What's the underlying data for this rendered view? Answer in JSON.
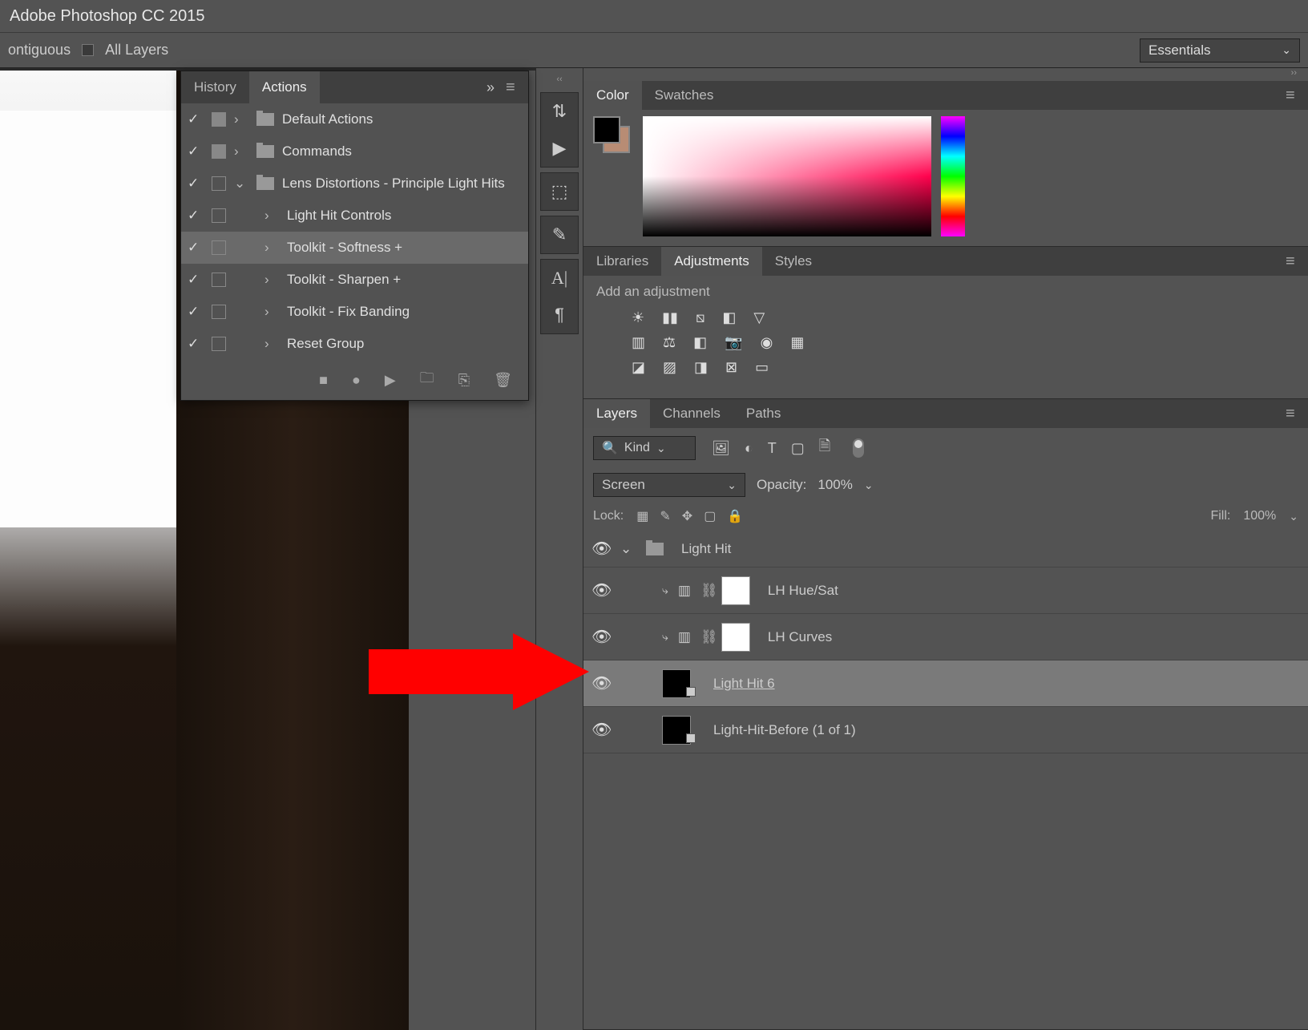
{
  "app": {
    "title": "Adobe Photoshop CC 2015"
  },
  "options": {
    "contiguous": "ontiguous",
    "all_layers": "All Layers"
  },
  "workspace": {
    "selected": "Essentials"
  },
  "history_panel": {
    "tabs": {
      "history": "History",
      "actions": "Actions"
    },
    "items": [
      {
        "check": true,
        "box": true,
        "expand": "›",
        "folder": true,
        "label": "Default Actions",
        "indent": 0
      },
      {
        "check": true,
        "box": true,
        "expand": "›",
        "folder": true,
        "label": "Commands",
        "indent": 0
      },
      {
        "check": true,
        "box": false,
        "expand": "⌄",
        "folder": true,
        "label": "Lens Distortions - Principle Light Hits",
        "indent": 0
      },
      {
        "check": true,
        "box": false,
        "expand": "›",
        "folder": false,
        "label": "Light Hit Controls",
        "indent": 1
      },
      {
        "check": true,
        "box": false,
        "expand": "›",
        "folder": false,
        "label": "Toolkit - Softness +",
        "indent": 1,
        "sel": true
      },
      {
        "check": true,
        "box": false,
        "expand": "›",
        "folder": false,
        "label": "Toolkit - Sharpen +",
        "indent": 1
      },
      {
        "check": true,
        "box": false,
        "expand": "›",
        "folder": false,
        "label": "Toolkit - Fix Banding",
        "indent": 1
      },
      {
        "check": true,
        "box": false,
        "expand": "›",
        "folder": false,
        "label": "Reset Group",
        "indent": 1
      }
    ]
  },
  "color_panel": {
    "tabs": {
      "color": "Color",
      "swatches": "Swatches"
    }
  },
  "adjustments_panel": {
    "tabs": {
      "libraries": "Libraries",
      "adjustments": "Adjustments",
      "styles": "Styles"
    },
    "title": "Add an adjustment"
  },
  "layers_panel": {
    "tabs": {
      "layers": "Layers",
      "channels": "Channels",
      "paths": "Paths"
    },
    "kind_label": "Kind",
    "blend_mode": "Screen",
    "opacity_label": "Opacity:",
    "opacity_value": "100%",
    "lock_label": "Lock:",
    "fill_label": "Fill:",
    "fill_value": "100%",
    "items": [
      {
        "type": "group",
        "name": "Light Hit"
      },
      {
        "type": "adj",
        "name": "LH Hue/Sat"
      },
      {
        "type": "adj",
        "name": "LH Curves"
      },
      {
        "type": "smart",
        "name": "Light Hit 6",
        "sel": true,
        "underline": true
      },
      {
        "type": "smart",
        "name": "Light-Hit-Before (1 of 1)"
      }
    ]
  }
}
